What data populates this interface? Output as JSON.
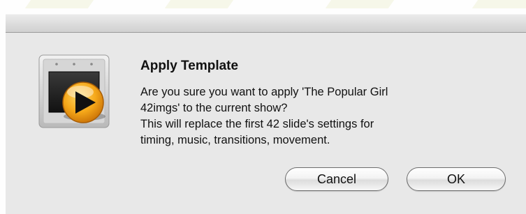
{
  "dialog": {
    "title": "Apply Template",
    "message_lines": [
      "Are you sure you want to apply 'The Popular Girl",
      "42imgs' to the current show?",
      "This will replace the first 42 slide's settings for",
      "timing, music, transitions, movement."
    ],
    "buttons": {
      "cancel": "Cancel",
      "ok": "OK"
    },
    "icon": "slideshow-play-icon"
  },
  "colors": {
    "sheet_background": "#e8e8e8",
    "play_badge": "#f2a516"
  }
}
